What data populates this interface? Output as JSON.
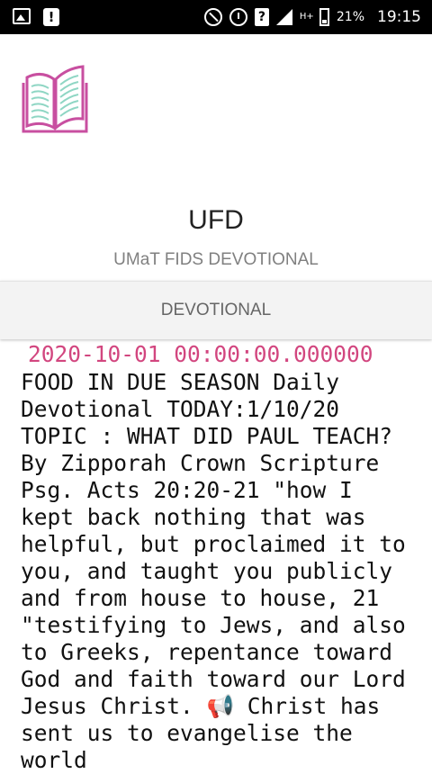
{
  "status_bar": {
    "battery": "21%",
    "time": "19:15",
    "network": "H+"
  },
  "header": {
    "logo_icon": "open-book-icon",
    "title": "UFD",
    "subtitle": "UMaT FIDS DEVOTIONAL"
  },
  "tab": {
    "label": "DEVOTIONAL"
  },
  "post": {
    "date": "2020-10-01 00:00:00.000000",
    "body": "FOOD IN DUE SEASON Daily Devotional TODAY:1/10/20 TOPIC : WHAT DID PAUL TEACH? By Zipporah Crown Scripture Psg. Acts 20:20-21 \"how I kept back nothing that was helpful, but proclaimed it to you, and taught you publicly and from house to house, 21 \"testifying to Jews, and also to Greeks, repentance toward God and faith toward our Lord Jesus Christ. 📢 Christ has sent us to evangelise the world"
  },
  "colors": {
    "accent": "#d2467f",
    "logo": "#c84fa0",
    "logo_lines": "#8fd6c4"
  }
}
